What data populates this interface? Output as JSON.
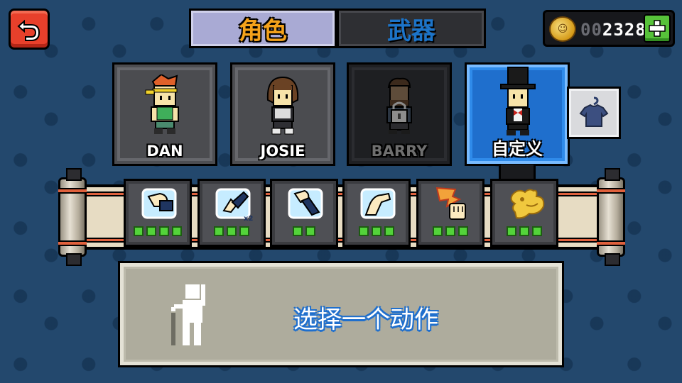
{
  "tabs": [
    {
      "label": "角色",
      "active": true
    },
    {
      "label": "武器",
      "active": false
    }
  ],
  "currency": {
    "count_leading_zeros": "00",
    "count_value": "2328",
    "icon": "coin-icon",
    "add_icon": "plus-icon"
  },
  "characters": [
    {
      "name": "DAN",
      "locked": false
    },
    {
      "name": "JOSIE",
      "locked": false
    },
    {
      "name": "BARRY",
      "locked": true
    },
    {
      "name": "自定义",
      "selected": true
    }
  ],
  "wardrobe_icon": "shirt-hanger-icon",
  "moves": [
    {
      "icon": "punch-fist-icon",
      "level": 4
    },
    {
      "icon": "double-kick-x2-icon",
      "badge": "x2",
      "level": 3
    },
    {
      "icon": "uppercut-fist-icon",
      "level": 2
    },
    {
      "icon": "flex-arm-icon",
      "level": 3
    },
    {
      "icon": "power-fist-icon",
      "level": 3
    },
    {
      "icon": "golden-dragon-fist-icon",
      "level": 3
    }
  ],
  "info": {
    "prompt": "选择一个动作",
    "figure_icon": "stick-figure-with-cane-icon"
  },
  "colors": {
    "background": "#23486d",
    "active_tab_text": "#f4a21b",
    "inactive_tab_text": "#1c74c9",
    "selected_card": "#2f8bea",
    "pip_green": "#53d33a",
    "back_button": "#e8402b"
  }
}
